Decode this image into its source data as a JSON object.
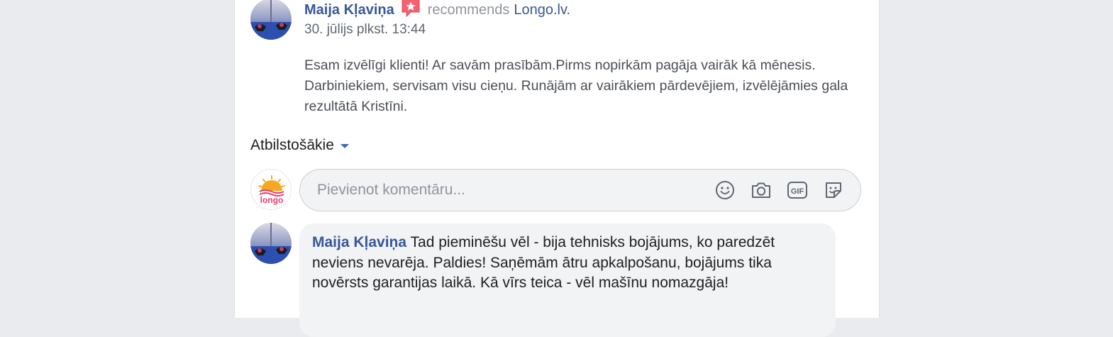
{
  "post": {
    "author_name": "Maija Kļaviņa",
    "recommends_text": "recommends",
    "page_name": "Longo.lv.",
    "date": "30. jūlijs plkst. 13:44",
    "body": "Esam izvēlīgi klienti! Ar savām prasībām.Pirms nopirkām pagāja vairāk kā mēnesis. Darbiniekiem, servisam visu cieņu. Runājām ar vairākiem pārdevējiem, izvēlējāmies gala rezultātā Kristīni."
  },
  "comments_sort": {
    "label": "Atbilstošākie"
  },
  "comment_box": {
    "placeholder": "Pievienot komentāru...",
    "icons": [
      "emoji-icon",
      "camera-icon",
      "gif-icon",
      "sticker-icon"
    ]
  },
  "page_avatar": {
    "logo_text": "longo"
  },
  "comments": [
    {
      "author": "Maija Kļaviņa",
      "text": "Tad pieminēšu vēl - bija tehnisks bojājums, ko paredzēt neviens nevarēja. Paldies! Saņēmām ātru apkalpošanu, bojājums tika novērsts garantijas laikā. Kā vīrs teica - vēl mašīnu nomazgāja!"
    }
  ],
  "colors": {
    "background": "#e9ebee",
    "link": "#385898",
    "accent": "#4267b2",
    "recommend_badge": "#f5616e",
    "logo_orange": "#f7a823",
    "logo_pink": "#e9396b"
  }
}
